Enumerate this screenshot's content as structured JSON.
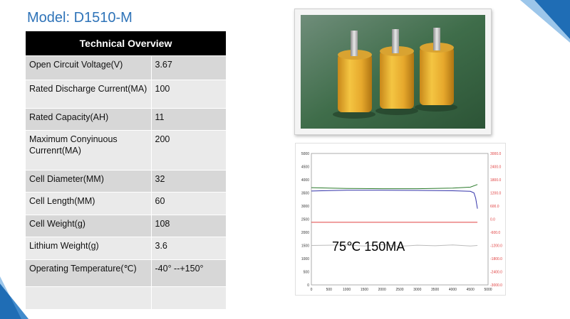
{
  "page": {
    "title": "Model: D1510-M"
  },
  "table": {
    "header": "Technical  Overview",
    "rows": [
      {
        "label": "Open Circuit Voltage(V)",
        "value": "3.67"
      },
      {
        "label": "Rated Discharge Current(MA)",
        "value": "100"
      },
      {
        "label": "Rated Capacity(AH)",
        "value": "11"
      },
      {
        "label": "Maximum Conyinuous Currenrt(MA)",
        "value": "200"
      },
      {
        "label": "Cell Diameter(MM)",
        "value": "32"
      },
      {
        "label": "Cell Length(MM)",
        "value": "60"
      },
      {
        "label": "Cell Weight(g)",
        "value": "108"
      },
      {
        "label": "Lithium Weight(g)",
        "value": "3.6"
      },
      {
        "label": "Operating Temperature(℃)",
        "value": "-40° --+150°"
      },
      {
        "label": "",
        "value": ""
      }
    ]
  },
  "photo": {
    "subject": "three yellow battery cells with metal tabs on green surface"
  },
  "chart_data": {
    "type": "line",
    "annotation": "75℃  150MA",
    "x_ticks": [
      "0",
      "500",
      "1000",
      "1500",
      "2000",
      "2500",
      "3000",
      "3500",
      "4000",
      "4500",
      "5000"
    ],
    "y_left_ticks": [
      "0",
      "500",
      "1000",
      "1500",
      "2000",
      "2500",
      "3000",
      "3500",
      "4000",
      "4500",
      "5000"
    ],
    "y_right_ticks": [
      "3000.0",
      "2400.0",
      "1800.0",
      "1200.0",
      "600.0",
      "0.0",
      "-600.0",
      "-1200.0",
      "-1800.0",
      "-2400.0",
      "-3000.0"
    ],
    "xlim": [
      0,
      5000
    ],
    "ylim_left": [
      0,
      5000
    ],
    "ylim_right": [
      -3000,
      3000
    ],
    "series": [
      {
        "x": [
          0,
          500,
          1000,
          2000,
          3000,
          4000,
          4500,
          4700
        ],
        "y": [
          3700,
          3680,
          3670,
          3660,
          3660,
          3680,
          3720,
          3820
        ],
        "color": "#2a7a2a"
      },
      {
        "x": [
          0,
          500,
          1000,
          2000,
          3000,
          4000,
          4500,
          4600,
          4650,
          4700
        ],
        "y": [
          3570,
          3590,
          3600,
          3600,
          3595,
          3580,
          3560,
          3500,
          3300,
          2900
        ],
        "color": "#3333aa"
      },
      {
        "x": [
          0,
          4700
        ],
        "y": [
          2380,
          2380
        ],
        "color": "#e04040"
      },
      {
        "x": [
          0,
          1000,
          1500,
          2000,
          2500,
          3000,
          3500,
          4000,
          4500,
          4700
        ],
        "y": [
          1500,
          1520,
          1480,
          1530,
          1470,
          1510,
          1490,
          1520,
          1480,
          1500
        ],
        "color": "#bbbbbb"
      }
    ]
  },
  "colors": {
    "title": "#2e73b8",
    "header_bg": "#000000",
    "row_dark": "#d7d7d7",
    "row_light": "#eaeaea",
    "accent_blue": "#1f6db5"
  }
}
